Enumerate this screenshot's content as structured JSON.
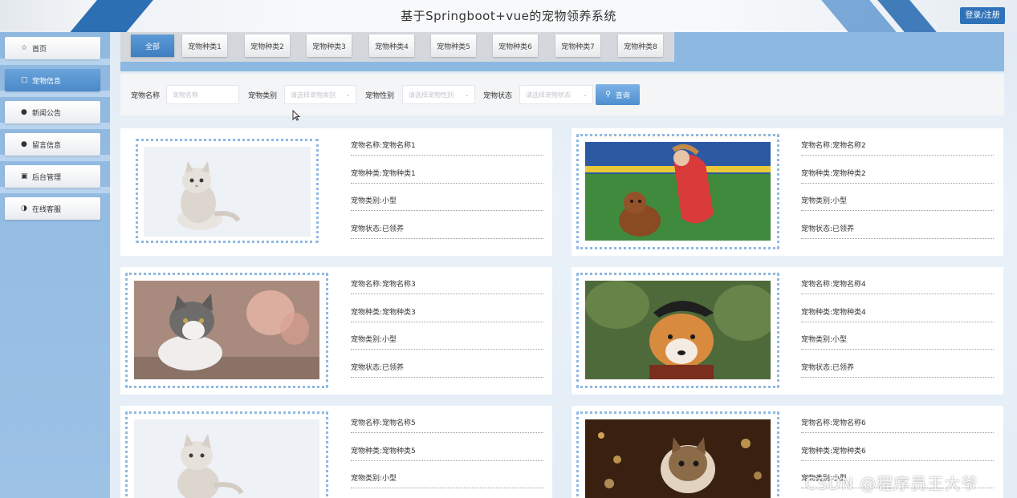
{
  "header": {
    "title": "基于Springboot+vue的宠物领养系统",
    "login_label": "登录/注册"
  },
  "sidebar": {
    "items": [
      {
        "label": "首页",
        "icon": "home-icon",
        "glyph": "☆",
        "active": false
      },
      {
        "label": "宠物信息",
        "icon": "bag-icon",
        "glyph": "▢",
        "active": true
      },
      {
        "label": "新闻公告",
        "icon": "info-icon",
        "glyph": "●",
        "active": false
      },
      {
        "label": "留言信息",
        "icon": "question-icon",
        "glyph": "●",
        "active": false
      },
      {
        "label": "后台管理",
        "icon": "briefcase-icon",
        "glyph": "▣",
        "active": false
      },
      {
        "label": "在线客服",
        "icon": "headset-icon",
        "glyph": "◑",
        "active": false
      }
    ]
  },
  "tabs": [
    {
      "label": "全部",
      "active": true
    },
    {
      "label": "宠物种类1",
      "active": false
    },
    {
      "label": "宠物种类2",
      "active": false
    },
    {
      "label": "宠物种类3",
      "active": false
    },
    {
      "label": "宠物种类4",
      "active": false
    },
    {
      "label": "宠物种类5",
      "active": false
    },
    {
      "label": "宠物种类6",
      "active": false
    },
    {
      "label": "宠物种类7",
      "active": false
    },
    {
      "label": "宠物种类8",
      "active": false
    }
  ],
  "search": {
    "name_label": "宠物名称",
    "name_placeholder": "宠物名称",
    "type_label": "宠物类别",
    "type_placeholder": "请选择宠物类别",
    "sex_label": "宠物性别",
    "sex_placeholder": "请选择宠物性别",
    "status_label": "宠物状态",
    "status_placeholder": "请选择宠物状态",
    "button_label": "查询"
  },
  "pets": [
    {
      "name": "宠物名称:宠物名称1",
      "kind": "宠物种类:宠物种类1",
      "category": "宠物类别:小型",
      "status": "宠物状态:已领养",
      "photo": "white-kitten"
    },
    {
      "name": "宠物名称:宠物名称2",
      "kind": "宠物种类:宠物种类2",
      "category": "宠物类别:小型",
      "status": "宠物状态:已领养",
      "photo": "poodle-with-woman"
    },
    {
      "name": "宠物名称:宠物名称3",
      "kind": "宠物种类:宠物种类3",
      "category": "宠物类别:小型",
      "status": "宠物状态:已领养",
      "photo": "grey-white-cat"
    },
    {
      "name": "宠物名称:宠物名称4",
      "kind": "宠物种类:宠物种类4",
      "category": "宠物类别:小型",
      "status": "宠物状态:已领养",
      "photo": "corgi-pirate"
    },
    {
      "name": "宠物名称:宠物名称5",
      "kind": "宠物种类:宠物种类5",
      "category": "宠物类别:小型",
      "status": "",
      "photo": "white-kitten"
    },
    {
      "name": "宠物名称:宠物名称6",
      "kind": "宠物种类:宠物种类6",
      "category": "宠物类别:小型",
      "status": "",
      "photo": "tabby-cat-lights"
    }
  ],
  "watermark": "CSDN @程序员王大爷",
  "colors": {
    "accent": "#2f72b8",
    "sidebar": "#9dc2e6",
    "frame": "#8fb9e2"
  }
}
